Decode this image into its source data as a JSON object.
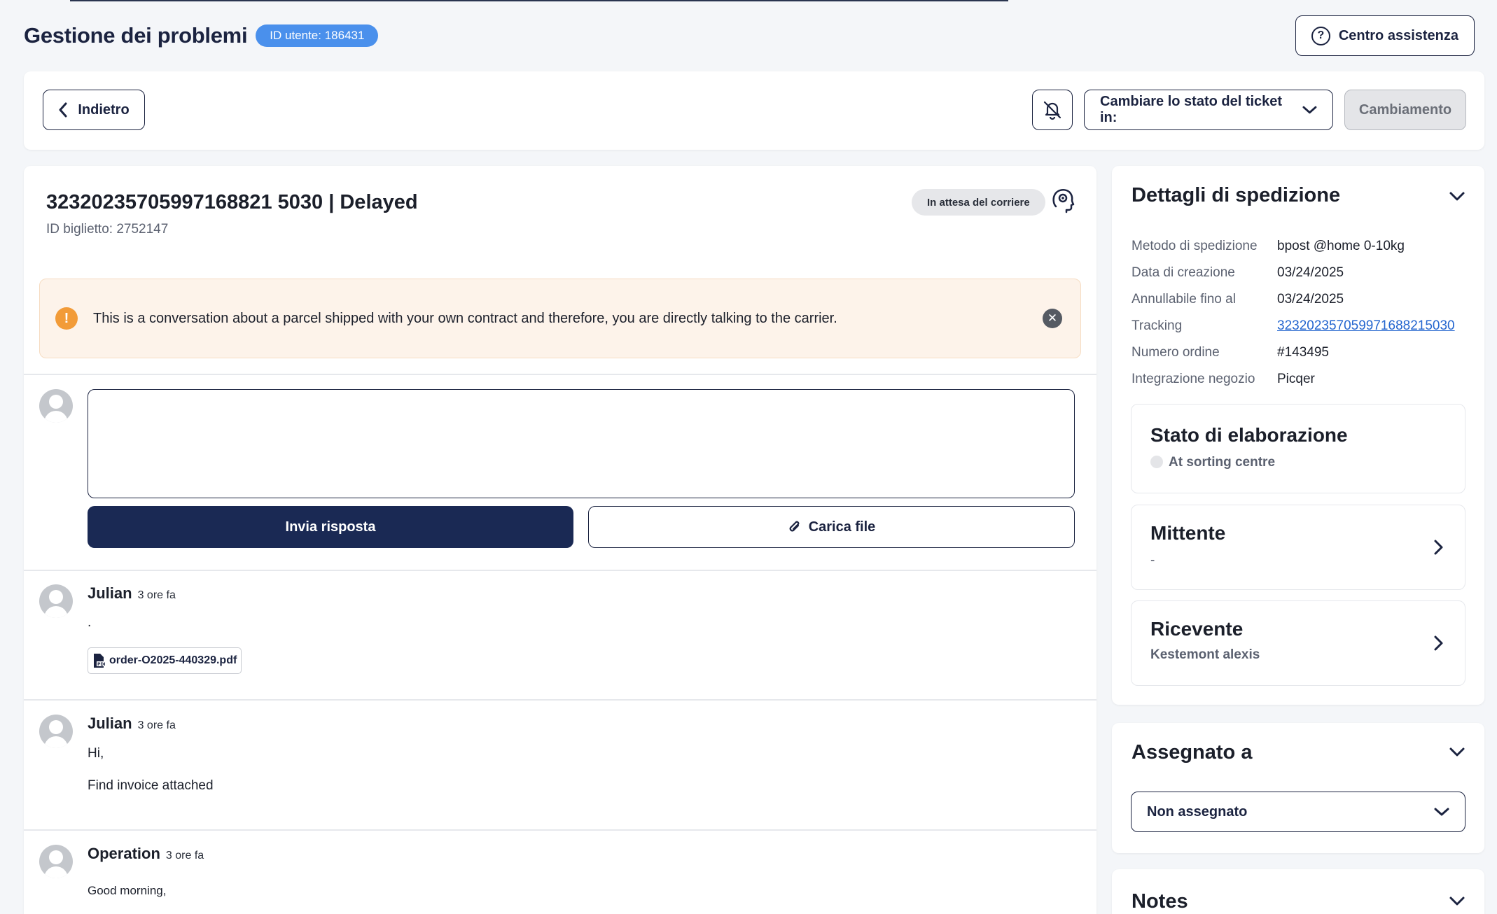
{
  "header": {
    "title": "Gestione dei problemi",
    "user_badge": "ID utente: 186431",
    "help_label": "Centro assistenza"
  },
  "toolbar": {
    "back_label": "Indietro",
    "status_select_label": "Cambiare lo stato del ticket in:",
    "change_label": "Cambiamento",
    "icons": {
      "notifications": "bell-off-icon"
    }
  },
  "ticket": {
    "title": "32320235705997168821 5030 | Delayed",
    "id_text": "ID biglietto: 2752147",
    "status_chip": "In attesa del corriere"
  },
  "alert": {
    "text": "This is a conversation about a parcel shipped with your own contract and therefore, you are directly talking to the carrier."
  },
  "reply": {
    "send_label": "Invia risposta",
    "upload_label": "Carica file"
  },
  "messages": [
    {
      "author": "Julian",
      "time": "3 ore fa",
      "lines": [
        "."
      ],
      "attachment": "order-O2025-440329.pdf"
    },
    {
      "author": "Julian",
      "time": "3 ore fa",
      "lines": [
        "Hi,",
        "Find invoice attached"
      ]
    },
    {
      "author": "Operation",
      "time": "3 ore fa",
      "lines": [
        "Good morning,"
      ]
    }
  ],
  "shipment": {
    "title": "Dettagli di spedizione",
    "rows": [
      {
        "label": "Metodo di spedizione",
        "value": "bpost @home 0-10kg"
      },
      {
        "label": "Data di creazione",
        "value": "03/24/2025"
      },
      {
        "label": "Annullabile fino al",
        "value": "03/24/2025"
      },
      {
        "label": "Tracking",
        "value": "323202357059971688215030"
      },
      {
        "label": "Numero ordine",
        "value": "#143495"
      },
      {
        "label": "Integrazione negozio",
        "value": "Picqer"
      }
    ],
    "processing": {
      "title": "Stato di elaborazione",
      "status": "At sorting centre"
    },
    "sender": {
      "title": "Mittente",
      "value": "-"
    },
    "recipient": {
      "title": "Ricevente",
      "value": "Kestemont alexis"
    }
  },
  "assigned": {
    "title": "Assegnato a",
    "value": "Non assegnato"
  },
  "notes": {
    "title": "Notes"
  },
  "colors": {
    "primary": "#1a2954",
    "badge": "#4a90ec",
    "alert_bg": "#fdf3ea",
    "alert_icon": "#f29b38",
    "link": "#2466cf"
  }
}
